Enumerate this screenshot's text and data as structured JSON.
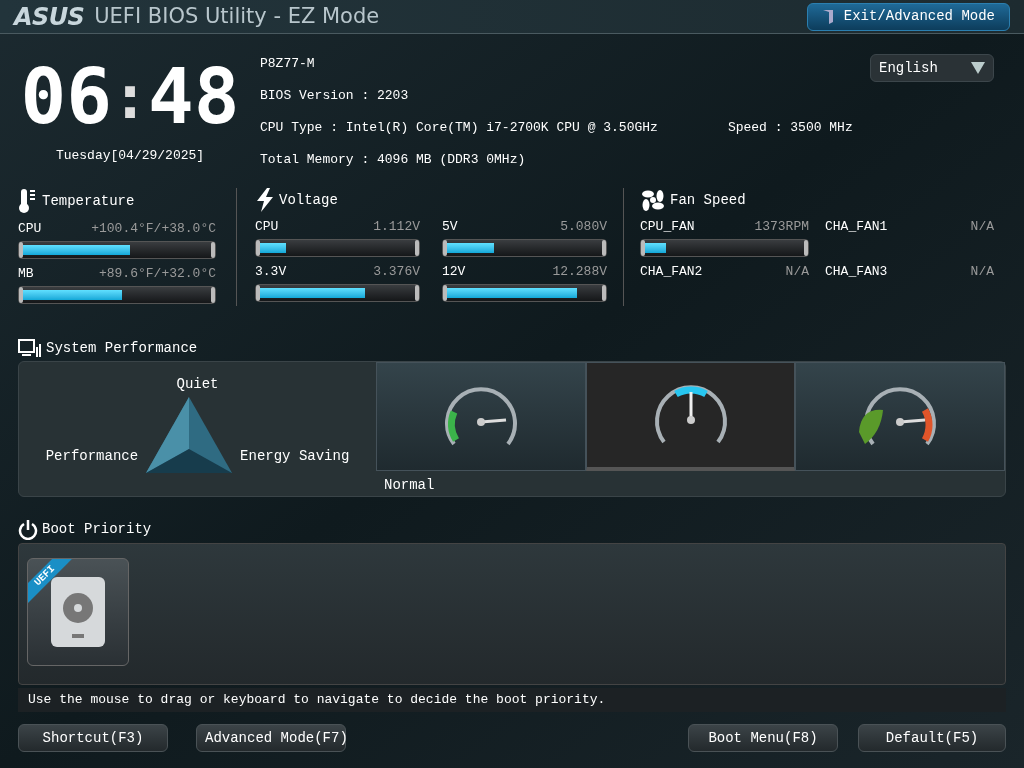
{
  "header": {
    "logo": "ASUS",
    "title": "UEFI BIOS Utility - EZ Mode",
    "exit_button": "Exit/Advanced Mode"
  },
  "clock": {
    "hours": "06",
    "separator": ":",
    "minutes": "48",
    "date": "Tuesday[04/29/2025]"
  },
  "system_info": {
    "model": "P8Z77-M",
    "bios_version": "BIOS Version : 2203",
    "cpu_type": "CPU Type : Intel(R) Core(TM) i7-2700K CPU @ 3.50GHz",
    "speed": "Speed : 3500 MHz",
    "total_memory": "Total Memory : 4096 MB (DDR3 0MHz)"
  },
  "language": {
    "value": "English"
  },
  "temperature": {
    "title": "Temperature",
    "items": [
      {
        "name": "CPU",
        "reading": "+100.4°F/+38.0°C",
        "level": 0.58
      },
      {
        "name": "MB",
        "reading": "+89.6°F/+32.0°C",
        "level": 0.54
      }
    ]
  },
  "voltage": {
    "title": "Voltage",
    "items": [
      {
        "name": "CPU",
        "reading": "1.112V",
        "level": 0.2
      },
      {
        "name": "5V",
        "reading": "5.080V",
        "level": 0.33
      },
      {
        "name": "3.3V",
        "reading": "3.376V",
        "level": 0.69
      },
      {
        "name": "12V",
        "reading": "12.288V",
        "level": 0.84
      }
    ]
  },
  "fan_speed": {
    "title": "Fan Speed",
    "items": [
      {
        "kind": "bar",
        "name": "CPU_FAN",
        "reading": "1373RPM",
        "level": 0.17
      },
      {
        "kind": "plain",
        "name": "CHA_FAN1",
        "reading": "N/A"
      },
      {
        "kind": "plain",
        "name": "CHA_FAN2",
        "reading": "N/A"
      },
      {
        "kind": "plain",
        "name": "CHA_FAN3",
        "reading": "N/A"
      }
    ]
  },
  "system_performance": {
    "title": "System Performance",
    "quiet": "Quiet",
    "performance": "Performance",
    "energy_saving": "Energy Saving",
    "modes": [
      {
        "kind": "eco",
        "selected": false
      },
      {
        "kind": "normal",
        "selected": true
      },
      {
        "kind": "turbo",
        "selected": false
      }
    ],
    "mode_label": "Normal"
  },
  "boot_priority": {
    "title": "Boot Priority",
    "devices": [
      {
        "badge": "UEFI"
      }
    ],
    "hint": "Use the mouse to drag or keyboard to navigate to decide the boot priority."
  },
  "buttons": [
    {
      "label": "Shortcut(F3)"
    },
    {
      "label": "Advanced Mode(F7)"
    },
    {
      "label": "Boot Menu(F8)"
    },
    {
      "label": "Default(F5)"
    }
  ]
}
